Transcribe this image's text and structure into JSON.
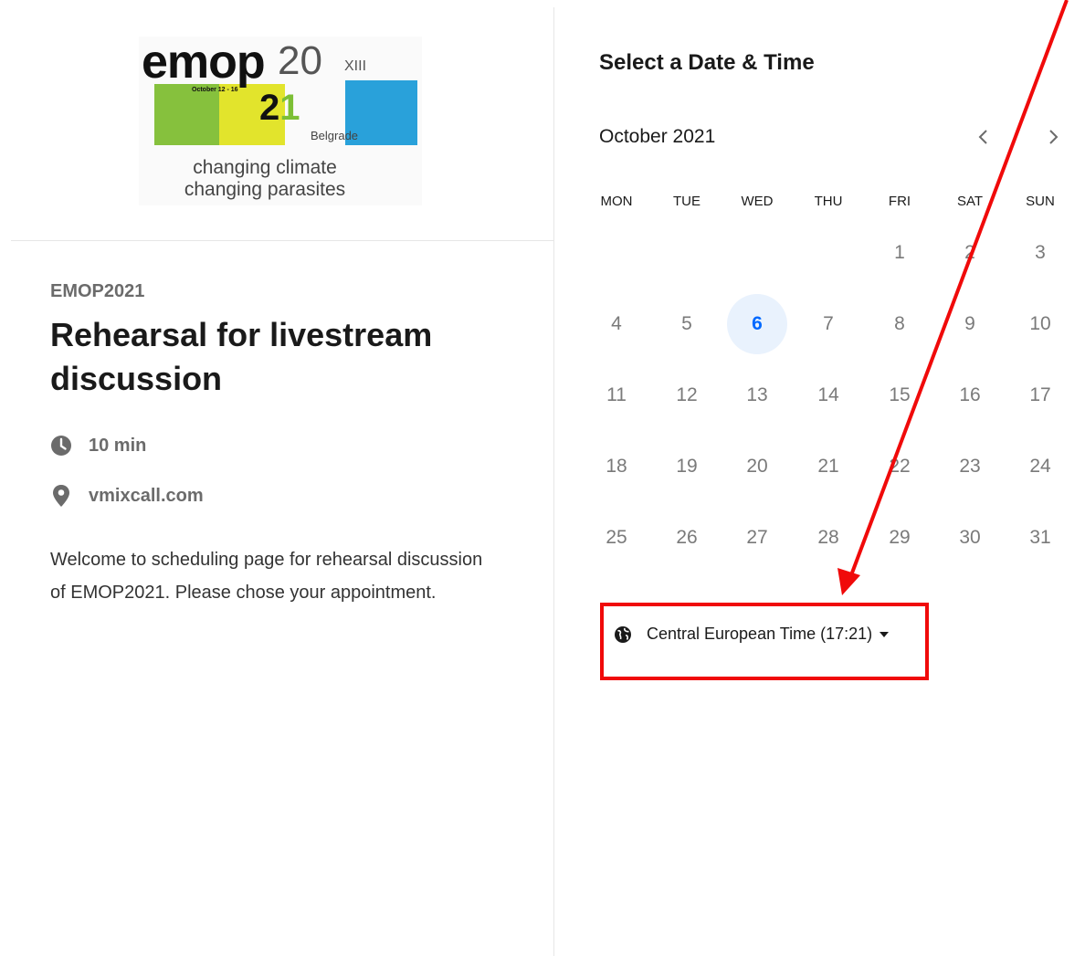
{
  "logo": {
    "wordmark": "emop",
    "dates": "October 12 - 16",
    "year_top": "20",
    "edition": "XIII",
    "year_bottom_a": "2",
    "year_bottom_b": "1",
    "city": "Belgrade",
    "tagline_line1": "changing climate",
    "tagline_line2": "changing parasites",
    "colors": {
      "green": "#86c13d",
      "yellow": "#e2e42c",
      "blue": "#29a1da"
    }
  },
  "event": {
    "organizer": "EMOP2021",
    "title": "Rehearsal for livestream discussion",
    "duration": "10 min",
    "duration_icon": "clock-icon",
    "location": "vmixcall.com",
    "location_icon": "map-pin-icon",
    "description": "Welcome to scheduling page for rehearsal discussion of EMOP2021. Please chose your appointment."
  },
  "calendar": {
    "heading": "Select a Date & Time",
    "month": "October 2021",
    "prev_icon": "chevron-left-icon",
    "next_icon": "chevron-right-icon",
    "weekdays": [
      "MON",
      "TUE",
      "WED",
      "THU",
      "FRI",
      "SAT",
      "SUN"
    ],
    "first_weekday_index": 4,
    "days_in_month": 31,
    "days": [
      "1",
      "2",
      "3",
      "4",
      "5",
      "6",
      "7",
      "8",
      "9",
      "10",
      "11",
      "12",
      "13",
      "14",
      "15",
      "16",
      "17",
      "18",
      "19",
      "20",
      "21",
      "22",
      "23",
      "24",
      "25",
      "26",
      "27",
      "28",
      "29",
      "30",
      "31"
    ],
    "selected_day": "6",
    "accent_color": "#0069ff",
    "selected_bg": "#e9f2fd"
  },
  "timezone": {
    "label": "Central European Time (17:21)",
    "icon": "globe-icon",
    "dropdown_icon": "caret-down-icon"
  },
  "annotation": {
    "color": "#f00a0a"
  }
}
